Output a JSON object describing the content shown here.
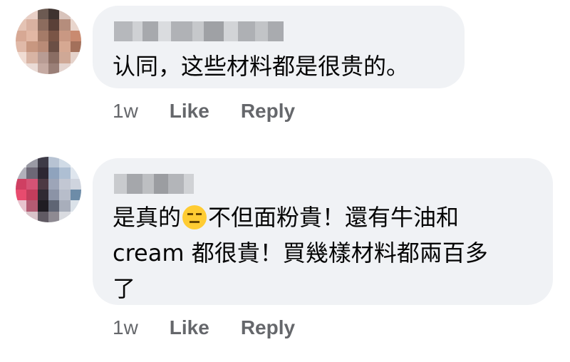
{
  "comments": [
    {
      "text": "认同，这些材料都是很贵的。",
      "timestamp": "1w",
      "like_label": "Like",
      "reply_label": "Reply"
    },
    {
      "text_before_emoji": "是真的",
      "emoji": "expressionless-face",
      "text_after_emoji": "不但面粉貴！還有牛油和\ncream 都很貴！買幾樣材料都兩百多\n了",
      "timestamp": "1w",
      "like_label": "Like",
      "reply_label": "Reply"
    }
  ],
  "colors": {
    "bubble": "#f0f2f5",
    "text": "#050505",
    "meta": "#65676b",
    "emoji": "#ffcc33"
  }
}
